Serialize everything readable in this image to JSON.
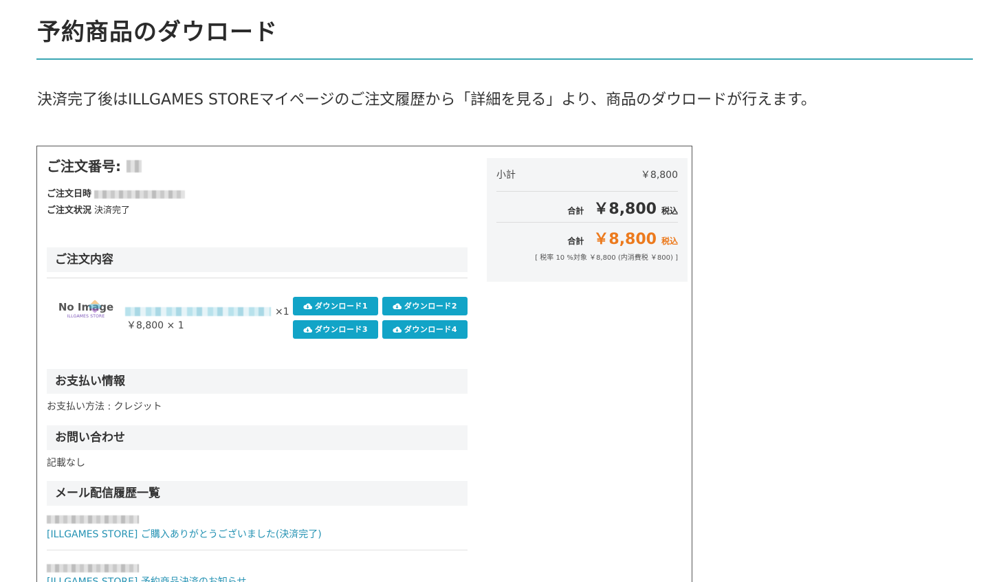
{
  "page": {
    "title": "予約商品のダウロード",
    "intro": "決済完了後はILLGAMES STOREマイページのご注文履歴から「詳細を見る」より、商品のダウロードが行えます。"
  },
  "order": {
    "number_label": "ご注文番号:",
    "date_label": "ご注文日時",
    "status_label": "ご注文状況",
    "status_value": "決済完了"
  },
  "items_section": {
    "heading": "ご注文内容",
    "no_image_label": "No Image",
    "no_image_sub": "ILLGAMES STORE",
    "qty_mark": "×1",
    "price_line": "￥8,800 × 1",
    "download_buttons": [
      "ダウンロード1",
      "ダウンロード2",
      "ダウンロード3",
      "ダウンロード4"
    ]
  },
  "payment_section": {
    "heading": "お支払い情報",
    "method": "お支払い方法 : クレジット"
  },
  "inquiry_section": {
    "heading": "お問い合わせ",
    "text": "記載なし"
  },
  "mail_section": {
    "heading": "メール配信履歴一覧",
    "mails": [
      {
        "subject": "[ILLGAMES STORE] ご購入ありがとうございました(決済完了)"
      },
      {
        "subject": "[ILLGAMES STORE] 予約商品決済のお知らせ"
      }
    ]
  },
  "summary": {
    "subtotal_label": "小計",
    "subtotal_value": "￥8,800",
    "total_label": "合計",
    "total_value": "￥8,800",
    "tax_incl": "税込",
    "total2_label": "合計",
    "total2_value": "￥8,800",
    "tax_incl2": "税込",
    "breakdown": "[ 税率 10 %対象 ￥8,800 (内消費税 ￥800) ]"
  },
  "colors": {
    "accent_rule": "#3aa6b3",
    "button_bg": "#12a4c7",
    "link": "#2492b3",
    "price_highlight": "#ec7a1d"
  },
  "icons": {
    "download_button_icon": "cloud-download-icon",
    "no_image_icon": "cube-logo-icon"
  }
}
